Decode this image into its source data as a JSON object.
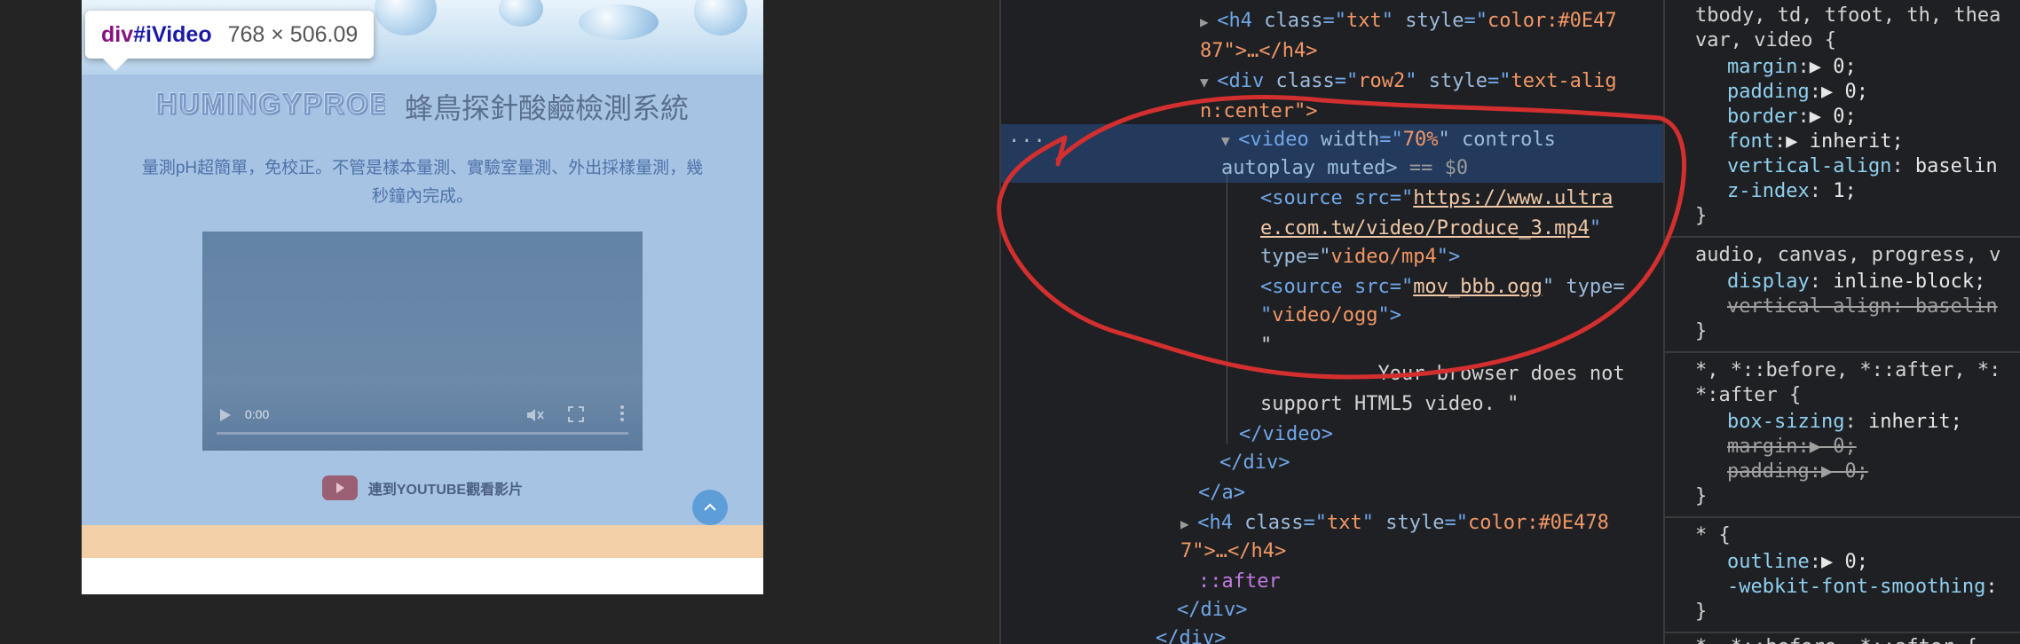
{
  "preview": {
    "tooltip": {
      "element": "div",
      "id_selector": "#iVideo",
      "size": "768 × 506.09"
    },
    "logo_text": "HUMINGYPROBE",
    "site_title": "蜂鳥探針酸鹼檢測系統",
    "description": "量測pH超簡單，免校正。不管是樣本量測、實驗室量測、外出採樣量測，幾秒鐘內完成。",
    "video": {
      "time": "0:00",
      "progress": 0
    },
    "youtube_link": "連到YOUTUBE觀看影片"
  },
  "colors": {
    "annotation": "#d32f2f",
    "selection": "#233a5c",
    "highlight_tag": "#881280"
  },
  "elements_panel": {
    "lines": [
      [
        "▶ ",
        "<h4 ",
        "class",
        "=\"",
        "txt",
        "\" ",
        "style",
        "=\"",
        "color:#0E47",
        ""
      ],
      [
        "87\">…</h4>"
      ],
      [
        "▼ ",
        "<div ",
        "class",
        "=\"",
        "row2",
        "\" ",
        "style",
        "=\"",
        "text-alig",
        ""
      ],
      [
        "n:center\">"
      ],
      [
        "▼ ",
        "<video ",
        "width",
        "=\"",
        "70%",
        "\" controls"
      ],
      [
        "autoplay muted>",
        " == $0"
      ],
      [
        "<source src=\"",
        "https://www.ultra"
      ],
      [
        "e.com.tw/video/Produce_3.mp4",
        "\""
      ],
      [
        "type=\"",
        "video/mp4",
        "\">"
      ],
      [
        "<source src=\"",
        "mov_bbb.ogg",
        "\" type="
      ],
      [
        "\"",
        "video/ogg",
        "\">"
      ],
      [
        "\""
      ],
      [
        "          Your browser does not"
      ],
      [
        "support HTML5 video. \""
      ],
      [
        "</video>"
      ],
      [
        "</div>"
      ],
      [
        "</a>"
      ],
      [
        "▶ ",
        "<h4 ",
        "class",
        "=\"",
        "txt",
        "\" ",
        "style",
        "=\"",
        "color:#0E478",
        ""
      ],
      [
        "7\">…</h4>"
      ],
      [
        "::after"
      ],
      [
        "</div>"
      ],
      [
        "</div>"
      ]
    ]
  },
  "styles_panel": {
    "rule1": {
      "selector_line1": "tbody, td, tfoot, th, thea",
      "selector_line2": "var, video {",
      "decls": [
        {
          "prop": "margin",
          "val": "▶ 0;"
        },
        {
          "prop": "padding",
          "val": "▶ 0;"
        },
        {
          "prop": "border",
          "val": "▶ 0;"
        },
        {
          "prop": "font",
          "val": "▶ inherit;"
        },
        {
          "prop": "vertical-align",
          "val": " baselin"
        },
        {
          "prop": "z-index",
          "val": " 1;"
        }
      ],
      "close": "}"
    },
    "rule2": {
      "selector": "audio, canvas, progress, v",
      "decls": [
        {
          "prop": "display",
          "val": " inline-block;"
        },
        {
          "prop": "vertical-align",
          "val": " baselin"
        }
      ],
      "close": "}"
    },
    "rule3": {
      "selector_line1": "*, *::before, *::after, *:",
      "selector_line2": "*:after {",
      "decls": [
        {
          "prop": "box-sizing",
          "val": " inherit;"
        },
        {
          "prop": "margin",
          "val": "▶ 0;"
        },
        {
          "prop": "padding",
          "val": "▶ 0;"
        }
      ],
      "close": "}"
    },
    "rule4": {
      "selector": "* {",
      "decls": [
        {
          "prop": "outline",
          "val": "▶ 0;"
        },
        {
          "prop": "-webkit-font-smoothing",
          "val": ":"
        }
      ],
      "close": "}"
    },
    "trailing": "*, *::before, *::after {"
  }
}
